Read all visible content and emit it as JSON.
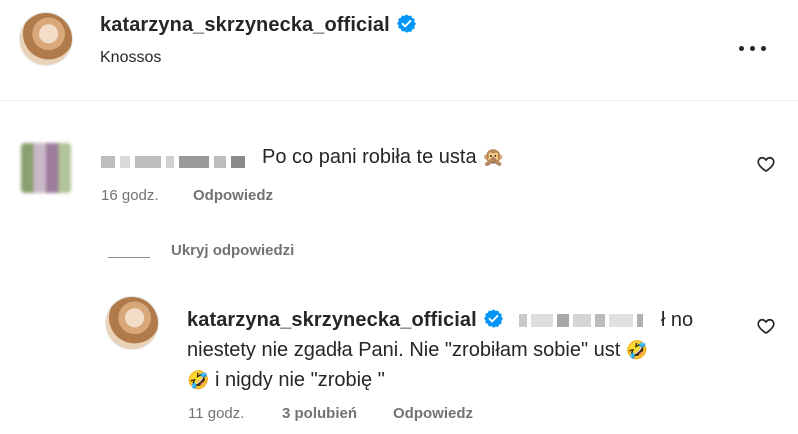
{
  "post": {
    "username": "katarzyna_skrzynecka_official",
    "location": "Knossos",
    "more_icon": "more-horizontal-icon"
  },
  "comment": {
    "text": "Po co pani robiła te usta",
    "emoji": "🙊",
    "time": "16 godz.",
    "reply_label": "Odpowiedz",
    "like_icon": "heart-outline-icon"
  },
  "replies": {
    "toggle_label": "Ukryj odpowiedzi"
  },
  "reply": {
    "username": "katarzyna_skrzynecka_official",
    "text_fragment_start": "ł no",
    "text_line2": "niestety nie zgadła Pani. Nie \"zrobiłam sobie\" ust",
    "emoji1": "🤣",
    "emoji2": "🤣",
    "text_line3": "i nigdy nie \"zrobię \"",
    "time": "11 godz.",
    "likes": "3 polubień",
    "reply_label": "Odpowiedz"
  },
  "colors": {
    "verified": "#0095f6",
    "text": "#262626",
    "secondary": "#737373"
  }
}
